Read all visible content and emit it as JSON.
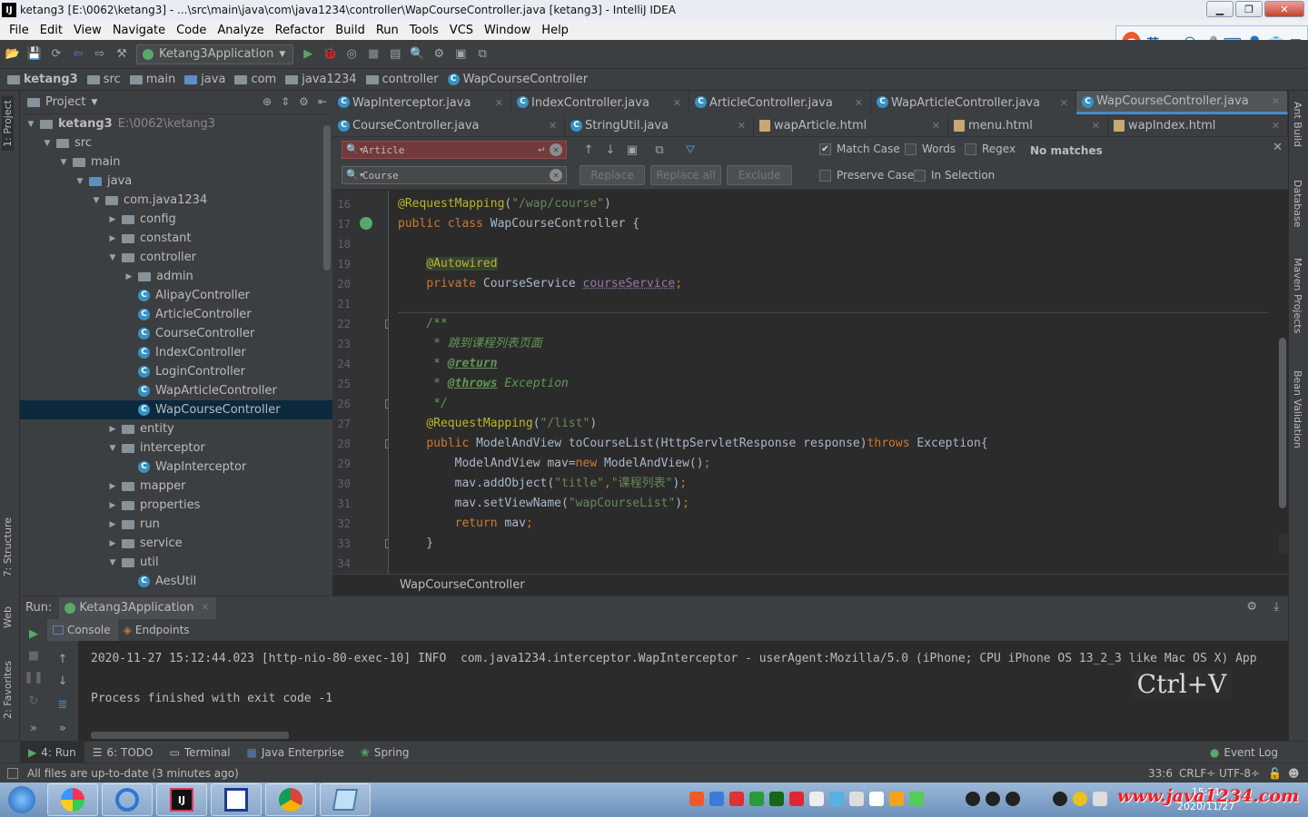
{
  "window": {
    "title": "ketang3 [E:\\0062\\ketang3] - ...\\src\\main\\java\\com\\java1234\\controller\\WapCourseController.java [ketang3] - IntelliJ IDEA"
  },
  "menu": [
    "File",
    "Edit",
    "View",
    "Navigate",
    "Code",
    "Analyze",
    "Refactor",
    "Build",
    "Run",
    "Tools",
    "VCS",
    "Window",
    "Help"
  ],
  "toolbar": {
    "run_config": "Ketang3Application"
  },
  "ime": {
    "lang": "英"
  },
  "breadcrumb": [
    "ketang3",
    "src",
    "main",
    "java",
    "com",
    "java1234",
    "controller",
    "WapCourseController"
  ],
  "left_stripe": {
    "project": "1: Project",
    "structure": "7: Structure",
    "web": "Web",
    "favorites": "2: Favorites"
  },
  "right_stripe": {
    "ant": "Ant Build",
    "database": "Database",
    "maven": "Maven Projects",
    "bean": "Bean Validation"
  },
  "project": {
    "title": "Project",
    "tree": [
      {
        "label": "ketang3",
        "path": "E:\\0062\\ketang3",
        "indent": 0,
        "type": "folder",
        "open": true,
        "bold": true
      },
      {
        "label": "src",
        "indent": 1,
        "type": "folder",
        "open": true
      },
      {
        "label": "main",
        "indent": 2,
        "type": "folder",
        "open": true
      },
      {
        "label": "java",
        "indent": 3,
        "type": "folder-blue",
        "open": true
      },
      {
        "label": "com.java1234",
        "indent": 4,
        "type": "folder",
        "open": true
      },
      {
        "label": "config",
        "indent": 5,
        "type": "folder",
        "open": false
      },
      {
        "label": "constant",
        "indent": 5,
        "type": "folder",
        "open": false
      },
      {
        "label": "controller",
        "indent": 5,
        "type": "folder",
        "open": true
      },
      {
        "label": "admin",
        "indent": 6,
        "type": "folder",
        "open": false
      },
      {
        "label": "AlipayController",
        "indent": 6,
        "type": "class"
      },
      {
        "label": "ArticleController",
        "indent": 6,
        "type": "class"
      },
      {
        "label": "CourseController",
        "indent": 6,
        "type": "class"
      },
      {
        "label": "IndexController",
        "indent": 6,
        "type": "class"
      },
      {
        "label": "LoginController",
        "indent": 6,
        "type": "class"
      },
      {
        "label": "WapArticleController",
        "indent": 6,
        "type": "class"
      },
      {
        "label": "WapCourseController",
        "indent": 6,
        "type": "class",
        "selected": true
      },
      {
        "label": "entity",
        "indent": 5,
        "type": "folder",
        "open": false
      },
      {
        "label": "interceptor",
        "indent": 5,
        "type": "folder",
        "open": true
      },
      {
        "label": "WapInterceptor",
        "indent": 6,
        "type": "class"
      },
      {
        "label": "mapper",
        "indent": 5,
        "type": "folder",
        "open": false
      },
      {
        "label": "properties",
        "indent": 5,
        "type": "folder",
        "open": false
      },
      {
        "label": "run",
        "indent": 5,
        "type": "folder",
        "open": false
      },
      {
        "label": "service",
        "indent": 5,
        "type": "folder",
        "open": false
      },
      {
        "label": "util",
        "indent": 5,
        "type": "folder",
        "open": true
      },
      {
        "label": "AesUtil",
        "indent": 6,
        "type": "class"
      }
    ]
  },
  "tabs_row1": [
    {
      "label": "WapInterceptor.java",
      "icon": "class"
    },
    {
      "label": "IndexController.java",
      "icon": "class"
    },
    {
      "label": "ArticleController.java",
      "icon": "class"
    },
    {
      "label": "WapArticleController.java",
      "icon": "class"
    },
    {
      "label": "WapCourseController.java",
      "icon": "class",
      "active": true
    }
  ],
  "tabs_row2": [
    {
      "label": "CourseController.java",
      "icon": "class"
    },
    {
      "label": "StringUtil.java",
      "icon": "class"
    },
    {
      "label": "wapArticle.html",
      "icon": "html"
    },
    {
      "label": "menu.html",
      "icon": "html"
    },
    {
      "label": "wapIndex.html",
      "icon": "html"
    }
  ],
  "find": {
    "search_value": "Article",
    "replace_value": "Course",
    "replace_label": "Replace",
    "replace_all_label": "Replace all",
    "exclude_label": "Exclude",
    "match_case": "Match Case",
    "words": "Words",
    "regex": "Regex",
    "no_matches": "No matches",
    "preserve_case": "Preserve Case",
    "in_selection": "In Selection"
  },
  "editor": {
    "line_numbers": [
      "16",
      "17",
      "18",
      "19",
      "20",
      "21",
      "22",
      "23",
      "24",
      "25",
      "26",
      "27",
      "28",
      "29",
      "30",
      "31",
      "32",
      "33",
      "34"
    ],
    "breadcrumb": "WapCourseController"
  },
  "run": {
    "label": "Run:",
    "config": "Ketang3Application",
    "tab_console": "Console",
    "tab_endpoints": "Endpoints",
    "log_line": "2020-11-27 15:12:44.023 [http-nio-80-exec-10] INFO  com.java1234.interceptor.WapInterceptor - userAgent:Mozilla/5.0 (iPhone; CPU iPhone OS 13_2_3 like Mac OS X) App",
    "exit_line": "Process finished with exit code -1",
    "overlay": "Ctrl+V"
  },
  "bottom_tabs": [
    {
      "label": "4: Run",
      "active": true
    },
    {
      "label": "6: TODO"
    },
    {
      "label": "Terminal"
    },
    {
      "label": "Java Enterprise"
    },
    {
      "label": "Spring"
    }
  ],
  "event_log": "Event Log",
  "status": {
    "message": "All files are up-to-date (3 minutes ago)",
    "position": "33:6",
    "line_sep": "CRLF÷",
    "encoding": "UTF-8÷"
  },
  "taskbar": {
    "time": "15:21",
    "date": "2020/11/27",
    "watermark": "www.java1234.com"
  }
}
